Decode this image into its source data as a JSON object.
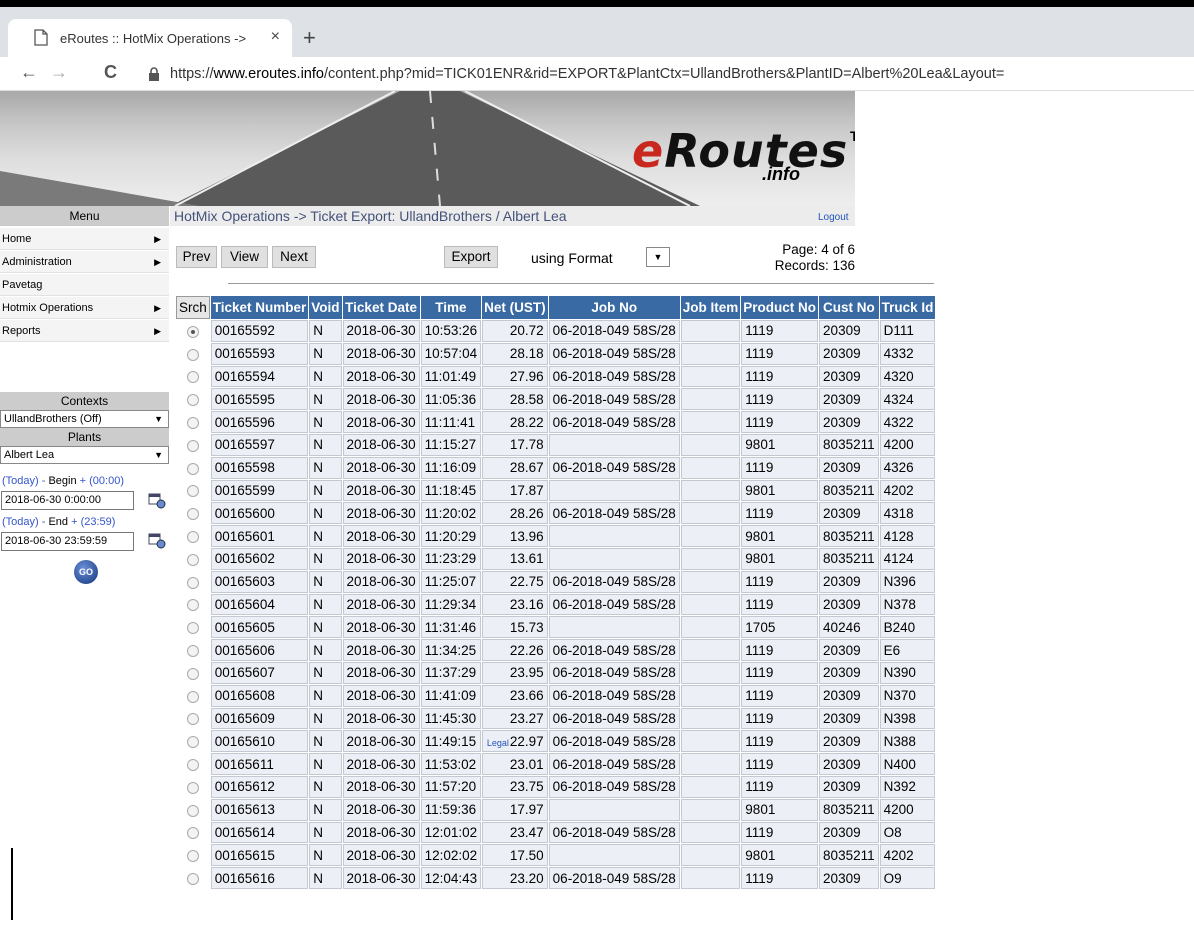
{
  "browser": {
    "tab_title": "eRoutes :: HotMix Operations ->",
    "tab_close": "×",
    "new_tab": "+",
    "back": "←",
    "forward": "→",
    "reload": "C",
    "url_prefix": "https://",
    "url_domain": "www.eroutes.info",
    "url_rest": "/content.php?mid=TICK01ENR&rid=EXPORT&PlantCtx=UllandBrothers&PlantID=Albert%20Lea&Layout="
  },
  "logo": {
    "e": "e",
    "main": "Routes",
    "tm": "TM",
    "info": ".info"
  },
  "menu": {
    "header": "Menu",
    "items": [
      {
        "label": "Home",
        "arrow": "▶"
      },
      {
        "label": "Administration",
        "arrow": "▶"
      },
      {
        "label": "Pavetag",
        "arrow": ""
      },
      {
        "label": "Hotmix Operations",
        "arrow": "▶"
      },
      {
        "label": "Reports",
        "arrow": "▶"
      }
    ]
  },
  "contexts": {
    "header": "Contexts",
    "selected": "UllandBrothers (Off)",
    "plants_header": "Plants",
    "plant_selected": "Albert Lea",
    "begin_label_pre": "(Today) - ",
    "begin_label_mid": "Begin",
    "begin_label_post": " + (00:00)",
    "begin_value": "2018-06-30 0:00:00",
    "end_label_pre": "(Today) - ",
    "end_label_mid": "End",
    "end_label_post": " + (23:59)",
    "end_value": "2018-06-30 23:59:59",
    "go": "GO"
  },
  "breadcrumb": "HotMix Operations -> Ticket Export: UllandBrothers / Albert Lea",
  "logout": "Logout",
  "toolbar": {
    "prev": "Prev",
    "view": "View",
    "next": "Next",
    "export": "Export",
    "using_format": "using Format",
    "page": "Page: 4 of 6",
    "records": "Records: 136"
  },
  "table": {
    "headers": [
      "Srch",
      "Ticket Number",
      "Void",
      "Ticket Date",
      "Time",
      "Net (UST)",
      "Job No",
      "Job Item",
      "Product No",
      "Cust No",
      "Truck Id"
    ],
    "rows": [
      {
        "sel": true,
        "ticket": "00165592",
        "void": "N",
        "date": "2018-06-30",
        "time": "10:53:26",
        "legal": "",
        "net": "20.72",
        "job": "06-2018-049 58S/28",
        "item": "",
        "product": "1119",
        "cust": "20309",
        "truck": "D111"
      },
      {
        "sel": false,
        "ticket": "00165593",
        "void": "N",
        "date": "2018-06-30",
        "time": "10:57:04",
        "legal": "",
        "net": "28.18",
        "job": "06-2018-049 58S/28",
        "item": "",
        "product": "1119",
        "cust": "20309",
        "truck": "4332"
      },
      {
        "sel": false,
        "ticket": "00165594",
        "void": "N",
        "date": "2018-06-30",
        "time": "11:01:49",
        "legal": "",
        "net": "27.96",
        "job": "06-2018-049 58S/28",
        "item": "",
        "product": "1119",
        "cust": "20309",
        "truck": "4320"
      },
      {
        "sel": false,
        "ticket": "00165595",
        "void": "N",
        "date": "2018-06-30",
        "time": "11:05:36",
        "legal": "",
        "net": "28.58",
        "job": "06-2018-049 58S/28",
        "item": "",
        "product": "1119",
        "cust": "20309",
        "truck": "4324"
      },
      {
        "sel": false,
        "ticket": "00165596",
        "void": "N",
        "date": "2018-06-30",
        "time": "11:11:41",
        "legal": "",
        "net": "28.22",
        "job": "06-2018-049 58S/28",
        "item": "",
        "product": "1119",
        "cust": "20309",
        "truck": "4322"
      },
      {
        "sel": false,
        "ticket": "00165597",
        "void": "N",
        "date": "2018-06-30",
        "time": "11:15:27",
        "legal": "",
        "net": "17.78",
        "job": "",
        "item": "",
        "product": "9801",
        "cust": "8035211",
        "truck": "4200"
      },
      {
        "sel": false,
        "ticket": "00165598",
        "void": "N",
        "date": "2018-06-30",
        "time": "11:16:09",
        "legal": "",
        "net": "28.67",
        "job": "06-2018-049 58S/28",
        "item": "",
        "product": "1119",
        "cust": "20309",
        "truck": "4326"
      },
      {
        "sel": false,
        "ticket": "00165599",
        "void": "N",
        "date": "2018-06-30",
        "time": "11:18:45",
        "legal": "",
        "net": "17.87",
        "job": "",
        "item": "",
        "product": "9801",
        "cust": "8035211",
        "truck": "4202"
      },
      {
        "sel": false,
        "ticket": "00165600",
        "void": "N",
        "date": "2018-06-30",
        "time": "11:20:02",
        "legal": "",
        "net": "28.26",
        "job": "06-2018-049 58S/28",
        "item": "",
        "product": "1119",
        "cust": "20309",
        "truck": "4318"
      },
      {
        "sel": false,
        "ticket": "00165601",
        "void": "N",
        "date": "2018-06-30",
        "time": "11:20:29",
        "legal": "",
        "net": "13.96",
        "job": "",
        "item": "",
        "product": "9801",
        "cust": "8035211",
        "truck": "4128"
      },
      {
        "sel": false,
        "ticket": "00165602",
        "void": "N",
        "date": "2018-06-30",
        "time": "11:23:29",
        "legal": "",
        "net": "13.61",
        "job": "",
        "item": "",
        "product": "9801",
        "cust": "8035211",
        "truck": "4124"
      },
      {
        "sel": false,
        "ticket": "00165603",
        "void": "N",
        "date": "2018-06-30",
        "time": "11:25:07",
        "legal": "",
        "net": "22.75",
        "job": "06-2018-049 58S/28",
        "item": "",
        "product": "1119",
        "cust": "20309",
        "truck": "N396"
      },
      {
        "sel": false,
        "ticket": "00165604",
        "void": "N",
        "date": "2018-06-30",
        "time": "11:29:34",
        "legal": "",
        "net": "23.16",
        "job": "06-2018-049 58S/28",
        "item": "",
        "product": "1119",
        "cust": "20309",
        "truck": "N378"
      },
      {
        "sel": false,
        "ticket": "00165605",
        "void": "N",
        "date": "2018-06-30",
        "time": "11:31:46",
        "legal": "",
        "net": "15.73",
        "job": "",
        "item": "",
        "product": "1705",
        "cust": "40246",
        "truck": "B240"
      },
      {
        "sel": false,
        "ticket": "00165606",
        "void": "N",
        "date": "2018-06-30",
        "time": "11:34:25",
        "legal": "",
        "net": "22.26",
        "job": "06-2018-049 58S/28",
        "item": "",
        "product": "1119",
        "cust": "20309",
        "truck": "E6"
      },
      {
        "sel": false,
        "ticket": "00165607",
        "void": "N",
        "date": "2018-06-30",
        "time": "11:37:29",
        "legal": "",
        "net": "23.95",
        "job": "06-2018-049 58S/28",
        "item": "",
        "product": "1119",
        "cust": "20309",
        "truck": "N390"
      },
      {
        "sel": false,
        "ticket": "00165608",
        "void": "N",
        "date": "2018-06-30",
        "time": "11:41:09",
        "legal": "",
        "net": "23.66",
        "job": "06-2018-049 58S/28",
        "item": "",
        "product": "1119",
        "cust": "20309",
        "truck": "N370"
      },
      {
        "sel": false,
        "ticket": "00165609",
        "void": "N",
        "date": "2018-06-30",
        "time": "11:45:30",
        "legal": "",
        "net": "23.27",
        "job": "06-2018-049 58S/28",
        "item": "",
        "product": "1119",
        "cust": "20309",
        "truck": "N398"
      },
      {
        "sel": false,
        "ticket": "00165610",
        "void": "N",
        "date": "2018-06-30",
        "time": "11:49:15",
        "legal": "Legal",
        "net": "22.97",
        "job": "06-2018-049 58S/28",
        "item": "",
        "product": "1119",
        "cust": "20309",
        "truck": "N388"
      },
      {
        "sel": false,
        "ticket": "00165611",
        "void": "N",
        "date": "2018-06-30",
        "time": "11:53:02",
        "legal": "",
        "net": "23.01",
        "job": "06-2018-049 58S/28",
        "item": "",
        "product": "1119",
        "cust": "20309",
        "truck": "N400"
      },
      {
        "sel": false,
        "ticket": "00165612",
        "void": "N",
        "date": "2018-06-30",
        "time": "11:57:20",
        "legal": "",
        "net": "23.75",
        "job": "06-2018-049 58S/28",
        "item": "",
        "product": "1119",
        "cust": "20309",
        "truck": "N392"
      },
      {
        "sel": false,
        "ticket": "00165613",
        "void": "N",
        "date": "2018-06-30",
        "time": "11:59:36",
        "legal": "",
        "net": "17.97",
        "job": "",
        "item": "",
        "product": "9801",
        "cust": "8035211",
        "truck": "4200"
      },
      {
        "sel": false,
        "ticket": "00165614",
        "void": "N",
        "date": "2018-06-30",
        "time": "12:01:02",
        "legal": "",
        "net": "23.47",
        "job": "06-2018-049 58S/28",
        "item": "",
        "product": "1119",
        "cust": "20309",
        "truck": "O8"
      },
      {
        "sel": false,
        "ticket": "00165615",
        "void": "N",
        "date": "2018-06-30",
        "time": "12:02:02",
        "legal": "",
        "net": "17.50",
        "job": "",
        "item": "",
        "product": "9801",
        "cust": "8035211",
        "truck": "4202"
      },
      {
        "sel": false,
        "ticket": "00165616",
        "void": "N",
        "date": "2018-06-30",
        "time": "12:04:43",
        "legal": "",
        "net": "23.20",
        "job": "06-2018-049 58S/28",
        "item": "",
        "product": "1119",
        "cust": "20309",
        "truck": "O9"
      }
    ]
  }
}
